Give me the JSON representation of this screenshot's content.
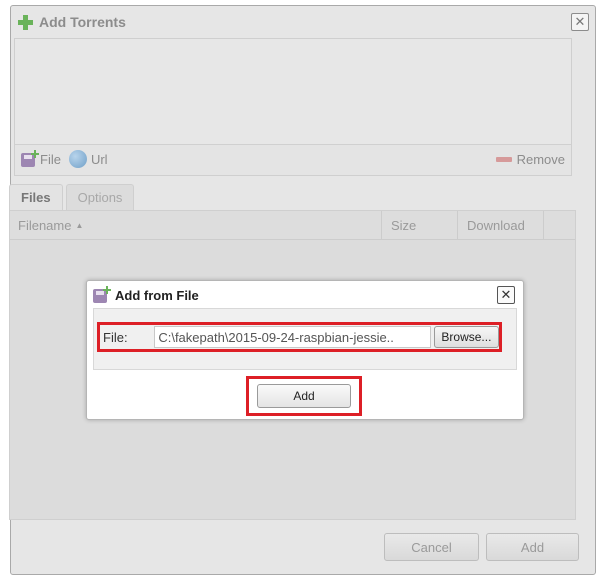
{
  "outer_dialog": {
    "title": "Add Torrents",
    "close_glyph": "✕",
    "toolbar": {
      "file_label": "File",
      "url_label": "Url",
      "remove_label": "Remove"
    },
    "tabs": [
      {
        "label": "Files",
        "active": true
      },
      {
        "label": "Options",
        "active": false
      }
    ],
    "files_table": {
      "columns": [
        "Filename",
        "Size",
        "Download"
      ],
      "sort_indicator": "▲"
    },
    "buttons": {
      "cancel_label": "Cancel",
      "add_label": "Add"
    }
  },
  "inner_dialog": {
    "title": "Add from File",
    "close_glyph": "✕",
    "file_label": "File:",
    "file_value": "C:\\fakepath\\2015-09-24-raspbian-jessie..",
    "browse_label": "Browse...",
    "add_label": "Add"
  },
  "icons": {
    "title_icon": "plus-icon",
    "file_icon": "disk-add-icon",
    "url_icon": "globe-icon",
    "remove_icon": "minus-icon"
  },
  "colors": {
    "highlight": "#dd1f26",
    "plus_green": "#6ab35a"
  }
}
